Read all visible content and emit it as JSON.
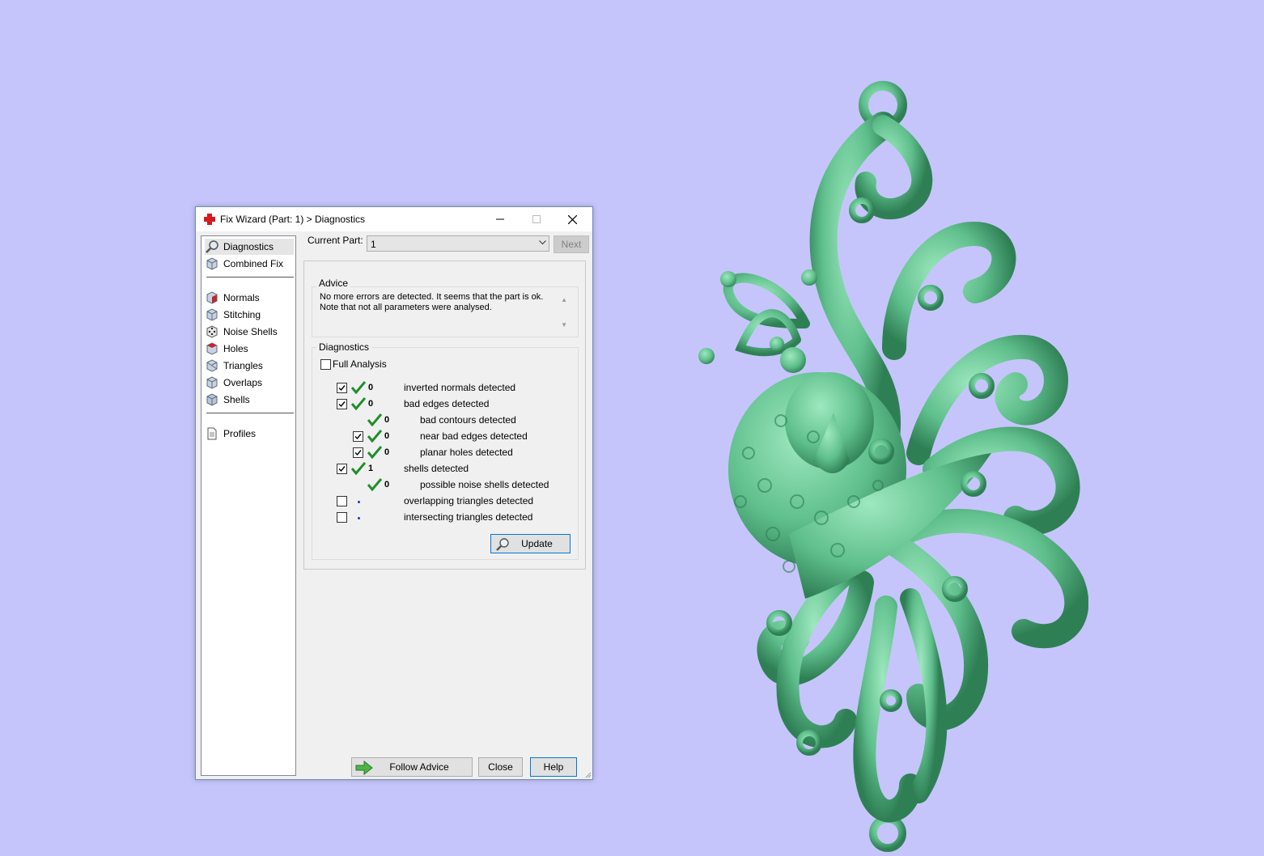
{
  "window": {
    "title": "Fix Wizard (Part: 1) > Diagnostics"
  },
  "sidebar": {
    "items": [
      {
        "label": "Diagnostics",
        "icon": "magnifier-icon"
      },
      {
        "label": "Combined Fix",
        "icon": "cube-icon"
      },
      {
        "label": "Normals",
        "icon": "normals-cube-icon"
      },
      {
        "label": "Stitching",
        "icon": "stitching-cube-icon"
      },
      {
        "label": "Noise Shells",
        "icon": "noise-shells-dice-icon"
      },
      {
        "label": "Holes",
        "icon": "holes-cube-icon"
      },
      {
        "label": "Triangles",
        "icon": "triangles-cube-icon"
      },
      {
        "label": "Overlaps",
        "icon": "overlaps-cube-icon"
      },
      {
        "label": "Shells",
        "icon": "shells-cube-icon"
      },
      {
        "label": "Profiles",
        "icon": "document-icon"
      }
    ],
    "selected": "Diagnostics"
  },
  "part": {
    "label": "Current Part:",
    "value": "1",
    "next_label": "Next"
  },
  "advice": {
    "group_label": "Advice",
    "text_line1": "No more errors are detected. It seems that the part is ok.",
    "text_line2": "Note that not all parameters were analysed."
  },
  "diagnostics": {
    "group_label": "Diagnostics",
    "full_analysis_label": "Full Analysis",
    "full_analysis_checked": false,
    "rows": [
      {
        "checkbox": true,
        "checked": true,
        "status": "ok",
        "count": "0",
        "text": "inverted normals detected"
      },
      {
        "checkbox": true,
        "checked": true,
        "status": "ok",
        "count": "0",
        "text": "bad edges detected"
      },
      {
        "checkbox": false,
        "checked": false,
        "status": "ok",
        "count": "0",
        "text": "bad contours detected"
      },
      {
        "checkbox": true,
        "checked": true,
        "status": "ok",
        "count": "0",
        "text": "near bad edges detected"
      },
      {
        "checkbox": true,
        "checked": true,
        "status": "ok",
        "count": "0",
        "text": "planar holes detected"
      },
      {
        "checkbox": true,
        "checked": true,
        "status": "ok",
        "count": "1",
        "text": "shells detected"
      },
      {
        "checkbox": false,
        "checked": false,
        "status": "ok",
        "count": "0",
        "text": "possible noise shells detected"
      },
      {
        "checkbox": true,
        "checked": false,
        "status": "not-analysed",
        "count": "",
        "text": "overlapping triangles detected"
      },
      {
        "checkbox": true,
        "checked": false,
        "status": "not-analysed",
        "count": "",
        "text": "intersecting triangles detected"
      }
    ],
    "update_label": "Update"
  },
  "footer": {
    "follow_advice_label": "Follow Advice",
    "close_label": "Close",
    "help_label": "Help"
  },
  "colors": {
    "desktop_bg": "#c5c5fb",
    "model_green": "#5fbf8c",
    "check_green": "#1e8f2a",
    "focus_blue": "#0078d7"
  }
}
